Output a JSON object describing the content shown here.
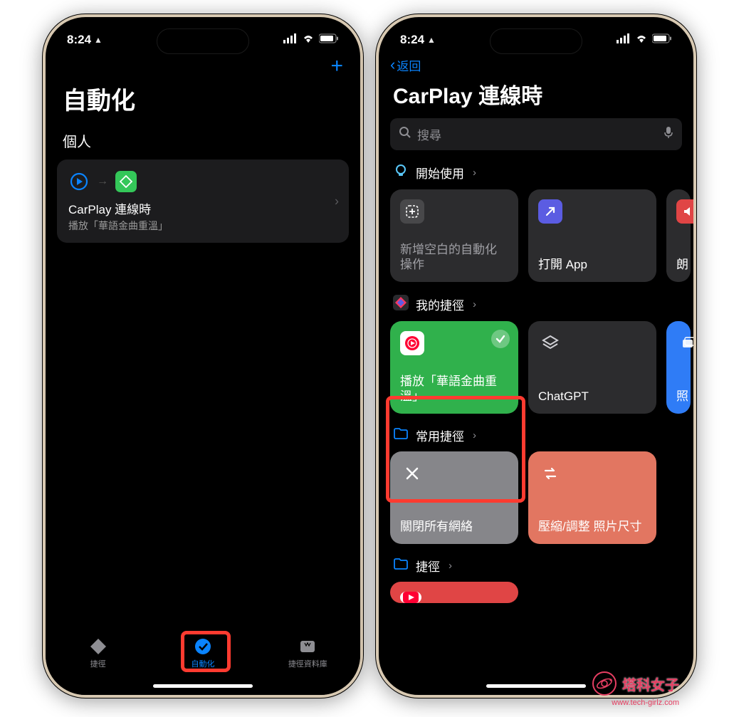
{
  "status": {
    "time": "8:24",
    "carplay_indicator": "▴"
  },
  "left": {
    "title": "自動化",
    "section": "個人",
    "card": {
      "title": "CarPlay 連線時",
      "subtitle": "播放「華語金曲重溫」"
    },
    "tabs": {
      "shortcuts": "捷徑",
      "automation": "自動化",
      "gallery": "捷徑資料庫"
    }
  },
  "right": {
    "back": "返回",
    "title": "CarPlay 連線時",
    "search_placeholder": "搜尋",
    "section_getting_started": "開始使用",
    "tile_blank": "新增空白的自動化操作",
    "tile_open_app": "打開 App",
    "tile_speak": "朗",
    "section_my_shortcuts": "我的捷徑",
    "tile_play_music": "播放「華語金曲重溫」",
    "tile_chatgpt": "ChatGPT",
    "tile_photos": "照",
    "section_common": "常用捷徑",
    "tile_close_network": "關閉所有網絡",
    "tile_compress": "壓縮/調整 照片尺寸",
    "section_shortcuts": "捷徑"
  },
  "watermark": {
    "title": "塔科女子",
    "url": "www.tech-girlz.com"
  }
}
